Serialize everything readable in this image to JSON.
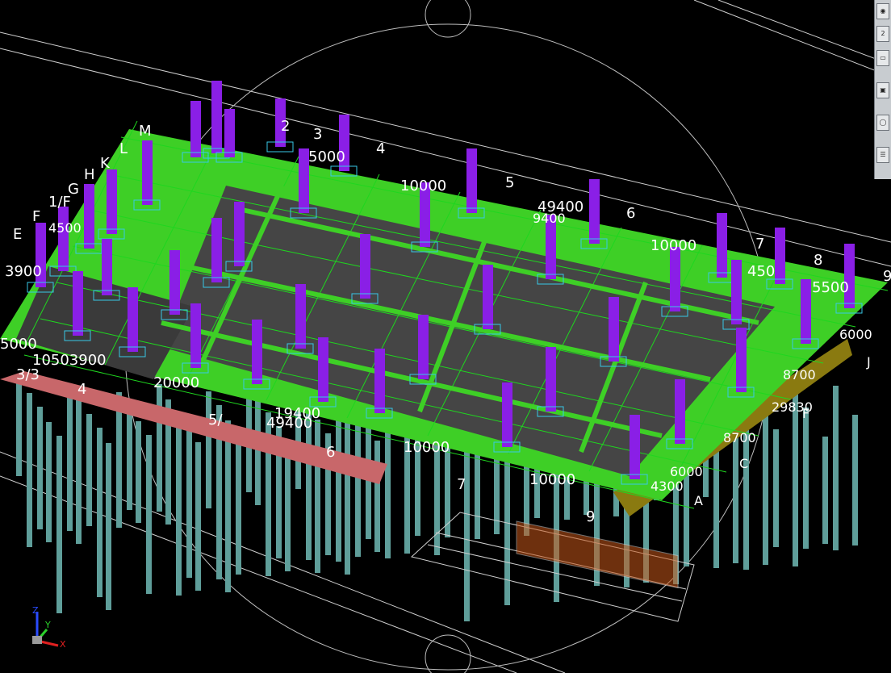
{
  "viewport": {
    "background": "#000000",
    "colors": {
      "slab": "#454545",
      "beam": "#3ecf26",
      "column": "#8a1fe6",
      "pile": "#5f9e9a",
      "cap_red": "#c8676a",
      "cap_olive": "#8a7a10",
      "grid_line": "#1fd61f",
      "frame_line": "#d8d8d8"
    },
    "dimensions_top": [
      "2",
      "3",
      "4",
      "5",
      "6",
      "7",
      "8",
      "9"
    ],
    "dimensions_left": [
      "M",
      "L",
      "K",
      "H",
      "G",
      "1/F",
      "F",
      "E"
    ],
    "dimensions_right": [
      "J",
      "F",
      "C",
      "A"
    ],
    "dimensions_bottom": [
      "3/3",
      "4",
      "5/",
      "6",
      "7",
      "9"
    ],
    "dim_values": {
      "d_10000_a": "10000",
      "d_49400_a": "49400",
      "d_9400": "9400",
      "d_10000_b": "10000",
      "d_4500": "450",
      "d_5500": "5500",
      "d_6000_r": "6000",
      "d_8700": "8700",
      "d_29830": "29830",
      "d_8700_b": "8700",
      "d_4300": "4300",
      "d_6000_b": "6000",
      "d_10000_c": "10000",
      "d_10000_d": "10000",
      "d_49400_b": "49400",
      "d_20000": "20000",
      "d_19400": "19400",
      "d_5000": "5000",
      "d_10503900": "10503900",
      "d_4500_l": "4500",
      "d_3900": "3900",
      "d_5000_t": "5000"
    }
  },
  "ucs_icon": {
    "z_label": "Z",
    "y_label": "Y",
    "x_label": "X"
  },
  "tool_panel": {
    "button_2": "2"
  }
}
